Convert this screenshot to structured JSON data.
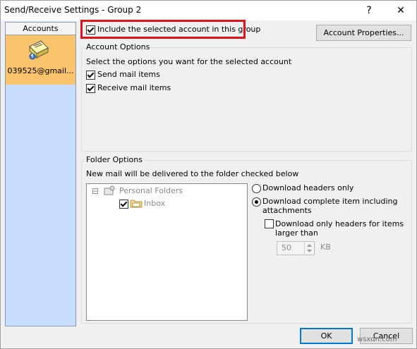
{
  "window": {
    "title": "Send/Receive Settings - Group 2",
    "help_glyph": "?",
    "close_glyph": "✕"
  },
  "sidebar": {
    "header": "Accounts",
    "account_label": "039525@gmail...",
    "account_icon": "mail-account-icon"
  },
  "include_account": {
    "label": "Include the selected account in this group",
    "checked": true
  },
  "account_properties_button": "Account Properties...",
  "account_options": {
    "title": "Account Options",
    "description": "Select the options you want for the selected account",
    "send_mail": {
      "label": "Send mail items",
      "checked": true
    },
    "receive_mail": {
      "label": "Receive mail items",
      "checked": true
    }
  },
  "folder_options": {
    "title": "Folder Options",
    "description": "New mail will be delivered to the folder checked below",
    "tree": {
      "expander": "⊟",
      "root": "Personal Folders",
      "child": "Inbox",
      "child_checked": true
    },
    "radios": {
      "headers_only": "Download headers only",
      "complete_line1": "Download complete item including",
      "complete_line2": "attachments",
      "selected": "complete"
    },
    "headers_larger": {
      "line1": "Download only headers for items",
      "line2": "larger than",
      "checked": false
    },
    "size_value": "50",
    "size_unit": "KB"
  },
  "buttons": {
    "ok": "OK",
    "cancel": "Cancel"
  },
  "watermark": "wsxdn.com"
}
